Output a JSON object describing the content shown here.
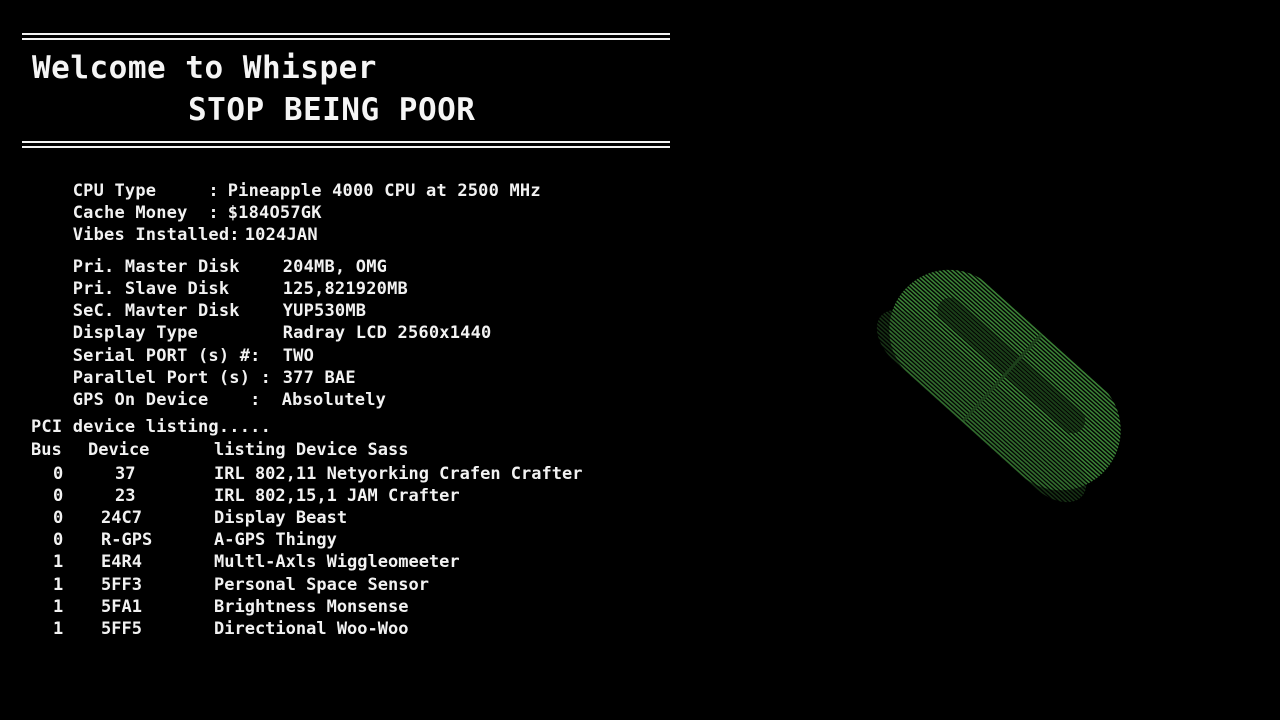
{
  "banner": {
    "line1": "Welcome to Whisper",
    "line2": "STOP BEING POOR"
  },
  "system": [
    {
      "key": "CPU Type     :",
      "value": "Pineapple 4000 CPU at 2500 MHz"
    },
    {
      "key": "Cache Money  :",
      "value": "$184O57GK"
    },
    {
      "key": "Vibes Installed:",
      "value": "1024JAN"
    }
  ],
  "disks": [
    {
      "key": "Pri. Master Disk",
      "value": "204MB, OMG"
    },
    {
      "key": "Pri. Slave Disk",
      "value": "125,821920MB"
    },
    {
      "key": "SeC. Mavter Disk",
      "value": "YUP530MB"
    },
    {
      "key": "Display Type",
      "value": "Radray LCD 2560x1440"
    },
    {
      "key": "Serial PORT (s) #:",
      "value": "TWO"
    },
    {
      "key": "Parallel Port (s) :",
      "value": "377 BAE"
    },
    {
      "key": "GPS On Device    :",
      "value": "Absolutely"
    }
  ],
  "pci": {
    "heading": "PCI device listing.....",
    "columns": {
      "bus": "Bus",
      "device": "Device",
      "listing": "listing Device Sass"
    },
    "rows": [
      {
        "bus": "0",
        "device": "37",
        "name": "IRL 802,11 Netyorking Crafen Crafter"
      },
      {
        "bus": "0",
        "device": "23",
        "name": "IRL 802,15,1 JAM Crafter"
      },
      {
        "bus": "0",
        "device": "24C7",
        "name": "Display Beast"
      },
      {
        "bus": "0",
        "device": "R-GPS",
        "name": "A-GPS Thingy"
      },
      {
        "bus": "1",
        "device": "E4R4",
        "name": "Multl-Axls Wiggleomeeter"
      },
      {
        "bus": "1",
        "device": "5FF3",
        "name": "Personal Space Sensor"
      },
      {
        "bus": "1",
        "device": "5FA1",
        "name": "Brightness Monsense"
      },
      {
        "bus": "1",
        "device": "5FF5",
        "name": "Directional Woo-Woo"
      }
    ]
  },
  "logo": {
    "icon": "pill-icon",
    "color": "#3f8a3a"
  }
}
